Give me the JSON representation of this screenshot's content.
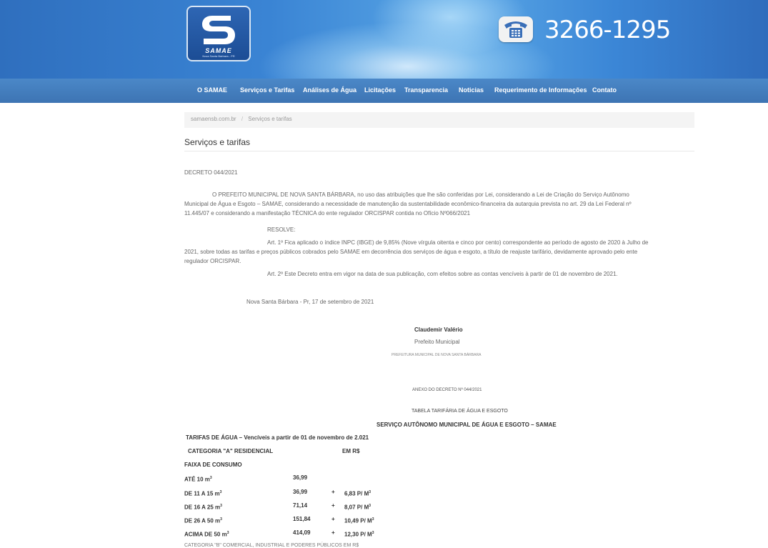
{
  "header": {
    "logo_text": "SAMAE",
    "logo_sub": "Nova Santa Bárbara - PR",
    "phone_number": "3266-1295",
    "phone_icon": "telephone-icon"
  },
  "nav": {
    "items": [
      {
        "label": "O SAMAE"
      },
      {
        "label": "Serviços e Tarifas"
      },
      {
        "label": "Análises de Água"
      },
      {
        "label": "Licitações"
      },
      {
        "label": "Transparencia"
      },
      {
        "label": "Noticias"
      },
      {
        "label": "Requerimento de Informações"
      },
      {
        "label": "Contato"
      }
    ]
  },
  "breadcrumb": {
    "home": "samaensb.com.br",
    "separator": "/",
    "current": "Serviços e tarifas"
  },
  "page": {
    "title": "Serviços e tarifas"
  },
  "decree": {
    "number": "DECRETO 044/2021",
    "intro_lines": [
      "O PREFEITO MUNICIPAL DE NOVA SANTA BÁRBARA, no uso das atribuições que lhe são conferidas por Lei, considerando a Lei de Criação do Serviço Autônomo",
      "Municipal de Água e Esgoto – SAMAE, considerando a necessidade de manutenção da sustentabilidade econômico-financeira da autarquia prevista no art. 29 da Lei Federal nº",
      "11.445/07 e considerando a manifestação TÉCNICA do ente regulador ORCISPAR contida no Ofício Nº066/2021"
    ],
    "resolve": "RESOLVE:",
    "art1_lines": [
      "Art. 1º Fica aplicado o índice INPC (IBGE) de 9,85% (Nove vírgula oitenta e cinco por cento) correspondente ao período de agosto de 2020 à Julho de",
      "2021, sobre todas as tarifas e preços públicos cobrados pelo SAMAE em decorrência dos serviços de água e esgoto, a título de reajuste tarifário, devidamente aprovado pelo ente",
      "regulador ORCISPAR."
    ],
    "art2": "Art. 2º Este Decreto entra em vigor na data de sua publicação, com efeitos sobre as contas vencíveis à partir de 01 de novembro de 2021.",
    "place_date": "Nova Santa Bárbara - Pr, 17 de setembro de 2021",
    "signer_name": "Claudemir Valério",
    "signer_role": "Prefeito Municipal",
    "signer_org": "PREFEITURA MUNICIPAL DE NOVA SANTA BÁRBARA"
  },
  "annex": {
    "title": "ANEXO DO DECRETO Nº 044/2021",
    "subtitle": "TABELA TARIFÁRIA DE ÁGUA E ESGOTO",
    "service": "SERVIÇO AUTÔNOMO MUNICIPAL DE ÁGUA E ESGOTO – SAMAE",
    "tariffs_heading": "TARIFAS DE ÁGUA – Vencíveis a partir de 01 de novembro de 2.021",
    "category_label": "CATEGORIA \"A\"  RESIDENCIAL",
    "currency_label": "EM  R$",
    "band_heading": "FAIXA DE CONSUMO",
    "rows": [
      {
        "range": "ATÉ 10 m",
        "base": "36,99",
        "plus": "",
        "rate": ""
      },
      {
        "range": "DE 11 A 15 m",
        "base": "36,99",
        "plus": "+",
        "rate": "6,83 P/ M"
      },
      {
        "range": "DE 16 A 25 m",
        "base": "71,14",
        "plus": "+",
        "rate": "8,07 P/ M"
      },
      {
        "range": "DE 26 A 50 m",
        "base": "151,84",
        "plus": "+",
        "rate": "10,49 P/ M"
      },
      {
        "range": "ACIMA DE 50 m",
        "base": "414,09",
        "plus": "+",
        "rate": "12,30 P/ M"
      }
    ],
    "cut_line": "CATEGORIA \"B\" COMERCIAL, INDUSTRIAL E PODERES PÚBLICOS     EM  R$"
  }
}
